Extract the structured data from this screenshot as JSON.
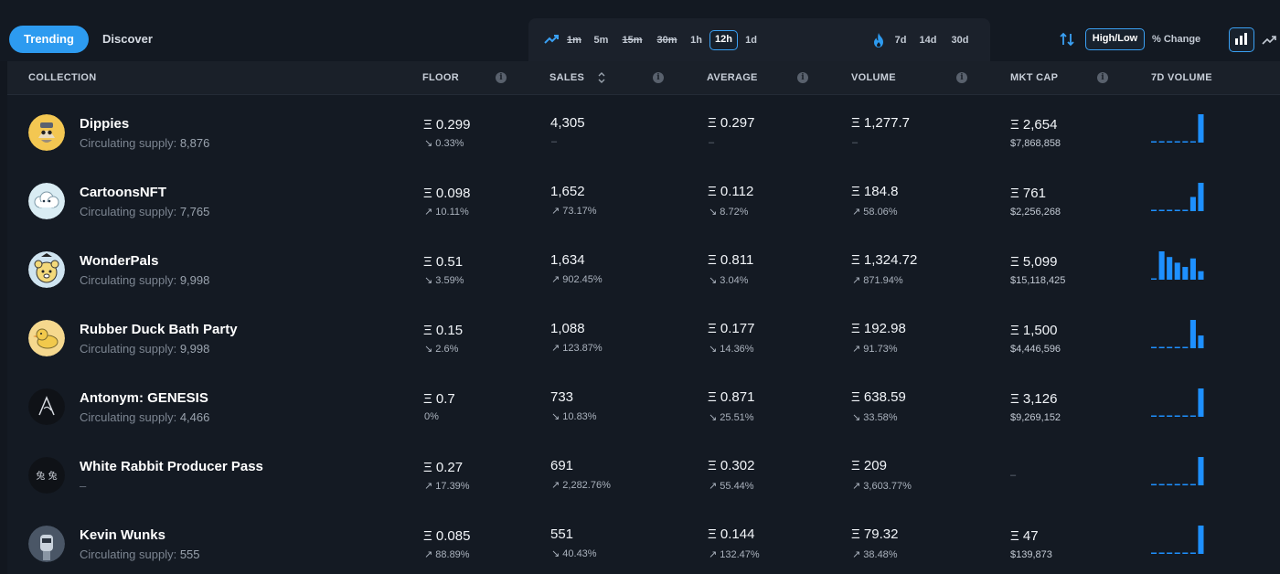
{
  "nav": {
    "tabs": [
      "Trending",
      "Discover"
    ]
  },
  "timeframes": {
    "short": [
      {
        "label": "1m",
        "struck": true,
        "active": false
      },
      {
        "label": "5m",
        "struck": false,
        "active": false
      },
      {
        "label": "15m",
        "struck": true,
        "active": false
      },
      {
        "label": "30m",
        "struck": true,
        "active": false
      },
      {
        "label": "1h",
        "struck": false,
        "active": false
      },
      {
        "label": "12h",
        "struck": false,
        "active": true
      },
      {
        "label": "1d",
        "struck": false,
        "active": false
      }
    ],
    "long": [
      {
        "label": "7d"
      },
      {
        "label": "14d"
      },
      {
        "label": "30d"
      }
    ]
  },
  "controls": {
    "highlow": "High/Low",
    "pct_change": "% Change"
  },
  "columns": {
    "collection": "COLLECTION",
    "floor": "FLOOR",
    "sales": "SALES",
    "average": "AVERAGE",
    "volume": "VOLUME",
    "mktcap": "MKT CAP",
    "vol7d": "7D VOLUME"
  },
  "colors": {
    "accent": "#2d9bf0",
    "up_arrow": "#cfd5dd",
    "bar": "#1e90ff"
  },
  "rows": [
    {
      "name": "Dippies",
      "supply_label": "Circulating supply:",
      "supply": "8,876",
      "avatar_icon": "dippies-avatar",
      "floor": "Ξ 0.299",
      "floor_chg": "↘ 0.33%",
      "sales": "4,305",
      "sales_chg": "–",
      "average": "Ξ 0.297",
      "average_chg": "–",
      "volume": "Ξ 1,277.7",
      "volume_chg": "–",
      "mktcap": "Ξ 2,654",
      "mktcap_usd": "$7,868,858",
      "spark": [
        0,
        0,
        0,
        0,
        0,
        0,
        1
      ]
    },
    {
      "name": "CartoonsNFT",
      "supply_label": "Circulating supply:",
      "supply": "7,765",
      "avatar_icon": "cartoons-avatar",
      "floor": "Ξ 0.098",
      "floor_chg": "↗ 10.11%",
      "sales": "1,652",
      "sales_chg": "↗ 73.17%",
      "average": "Ξ 0.112",
      "average_chg": "↘ 8.72%",
      "volume": "Ξ 184.8",
      "volume_chg": "↗ 58.06%",
      "mktcap": "Ξ 761",
      "mktcap_usd": "$2,256,268",
      "spark": [
        0,
        0,
        0,
        0,
        0,
        0.5,
        1
      ]
    },
    {
      "name": "WonderPals",
      "supply_label": "Circulating supply:",
      "supply": "9,998",
      "avatar_icon": "wonderpals-avatar",
      "floor": "Ξ 0.51",
      "floor_chg": "↘ 3.59%",
      "sales": "1,634",
      "sales_chg": "↗ 902.45%",
      "average": "Ξ 0.811",
      "average_chg": "↘ 3.04%",
      "volume": "Ξ 1,324.72",
      "volume_chg": "↗ 871.94%",
      "mktcap": "Ξ 5,099",
      "mktcap_usd": "$15,118,425",
      "spark": [
        0,
        1,
        0.8,
        0.6,
        0.45,
        0.75,
        0.3
      ]
    },
    {
      "name": "Rubber Duck Bath Party",
      "supply_label": "Circulating supply:",
      "supply": "9,998",
      "avatar_icon": "duck-avatar",
      "floor": "Ξ 0.15",
      "floor_chg": "↘ 2.6%",
      "sales": "1,088",
      "sales_chg": "↗ 123.87%",
      "average": "Ξ 0.177",
      "average_chg": "↘ 14.36%",
      "volume": "Ξ 192.98",
      "volume_chg": "↗ 91.73%",
      "mktcap": "Ξ 1,500",
      "mktcap_usd": "$4,446,596",
      "spark": [
        0,
        0,
        0,
        0,
        0,
        1,
        0.45
      ]
    },
    {
      "name": "Antonym: GENESIS",
      "supply_label": "Circulating supply:",
      "supply": "4,466",
      "avatar_icon": "antonym-avatar",
      "floor": "Ξ 0.7",
      "floor_chg": "0%",
      "sales": "733",
      "sales_chg": "↘ 10.83%",
      "average": "Ξ 0.871",
      "average_chg": "↘ 25.51%",
      "volume": "Ξ 638.59",
      "volume_chg": "↘ 33.58%",
      "mktcap": "Ξ 3,126",
      "mktcap_usd": "$9,269,152",
      "spark": [
        0,
        0,
        0,
        0,
        0,
        0,
        1
      ]
    },
    {
      "name": "White Rabbit Producer Pass",
      "supply_label": "",
      "supply": "–",
      "avatar_icon": "white-rabbit-avatar",
      "floor": "Ξ 0.27",
      "floor_chg": "↗ 17.39%",
      "sales": "691",
      "sales_chg": "↗ 2,282.76%",
      "average": "Ξ 0.302",
      "average_chg": "↗ 55.44%",
      "volume": "Ξ 209",
      "volume_chg": "↗ 3,603.77%",
      "mktcap": "–",
      "mktcap_usd": "",
      "spark": [
        0,
        0,
        0,
        0,
        0,
        0,
        1
      ]
    },
    {
      "name": "Kevin Wunks",
      "supply_label": "Circulating supply:",
      "supply": "555",
      "avatar_icon": "kevin-avatar",
      "floor": "Ξ 0.085",
      "floor_chg": "↗ 88.89%",
      "sales": "551",
      "sales_chg": "↘ 40.43%",
      "average": "Ξ 0.144",
      "average_chg": "↗ 132.47%",
      "volume": "Ξ 79.32",
      "volume_chg": "↗ 38.48%",
      "mktcap": "Ξ 47",
      "mktcap_usd": "$139,873",
      "spark": [
        0,
        0,
        0,
        0,
        0,
        0,
        1
      ]
    }
  ]
}
